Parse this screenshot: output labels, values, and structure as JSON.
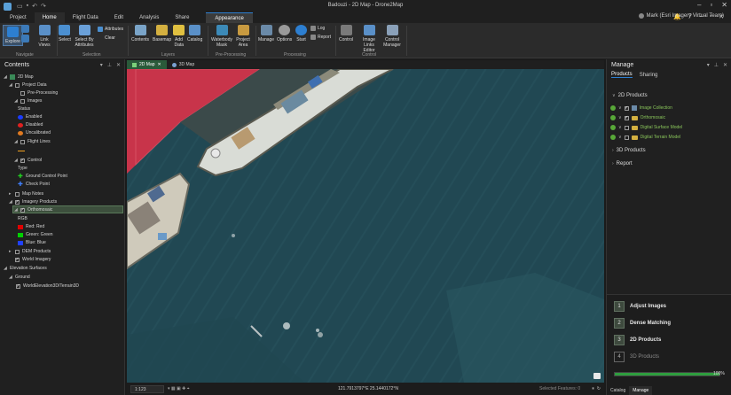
{
  "window": {
    "title": "Badouzi - 2D Map - Drone2Map"
  },
  "ribbon_tabs": [
    "Project",
    "Home",
    "Flight Data",
    "Edit",
    "Analysis",
    "Share",
    "Appearance"
  ],
  "user": {
    "name": "Mark (Esri Imagery Virtual Team)"
  },
  "ribbon": {
    "explore": "Explore",
    "link_views": "Link Views",
    "select": "Select",
    "select_by_attributes": "Select By Attributes",
    "attributes": "Attributes",
    "clear": "Clear",
    "contents": "Contents",
    "basemap": "Basemap",
    "add_data": "Add Data",
    "catalog": "Catalog",
    "waterbody_mask": "Waterbody Mask",
    "project_area": "Project Area",
    "manage": "Manage",
    "options": "Options",
    "start": "Start",
    "log": "Log",
    "report": "Report",
    "control": "Control",
    "image_links_editor": "Image Links Editor",
    "control_manager": "Control Manager",
    "groups": [
      "Navigate",
      "Selection",
      "Layers",
      "Pre-Processing",
      "Processing",
      "Control"
    ]
  },
  "contents": {
    "title": "Contents",
    "tree": {
      "map": "2D Map",
      "project_data": "Project Data",
      "pre_processing": "Pre-Processing",
      "images": "Images",
      "status": "Status",
      "enabled": "Enabled",
      "disabled": "Disabled",
      "uncalibrated": "Uncalibrated",
      "flight_lines": "Flight Lines",
      "control": "Control",
      "type": "Type",
      "gcp": "Ground Control Point",
      "check_point": "Check Point",
      "map_notes": "Map Notes",
      "imagery_products": "Imagery Products",
      "orthomosaic": "Orthomosaic",
      "rgb": "RGB",
      "red": "Red:  Red",
      "green": "Green: Green",
      "blue": "Blue:  Blue",
      "dem_products": "DEM Products",
      "world_imagery": "World Imagery",
      "elevation_surfaces": "Elevation Surfaces",
      "ground": "Ground",
      "terrain": "WorldElevation3D/Terrain3D"
    },
    "colors": {
      "enabled": "#1a3cff",
      "disabled": "#e02020",
      "uncalibrated": "#e07a20",
      "flight": "#f0a020",
      "red": "#e00000",
      "green": "#00d000",
      "blue": "#2040ff"
    }
  },
  "map": {
    "tabs": [
      "2D Map",
      "3D Map"
    ],
    "scale": "1:123",
    "coordinates": "121.7913797°E 25.1440172°N",
    "selected_features": "Selected Features: 0"
  },
  "manage": {
    "title": "Manage",
    "tabs": [
      "Products",
      "Sharing"
    ],
    "sections": {
      "2d": "2D Products",
      "3d": "3D Products",
      "report": "Report"
    },
    "products": [
      "Image Collection",
      "Orthomosaic",
      "Digital Surface Model",
      "Digital Terrain Model"
    ],
    "steps": [
      {
        "num": "1",
        "label": "Adjust Images"
      },
      {
        "num": "2",
        "label": "Dense Matching"
      },
      {
        "num": "3",
        "label": "2D Products"
      },
      {
        "num": "4",
        "label": "3D Products"
      }
    ],
    "progress_percent": 100,
    "progress_label": "100%",
    "bottom_tabs": [
      "Catalog",
      "Manage"
    ]
  }
}
